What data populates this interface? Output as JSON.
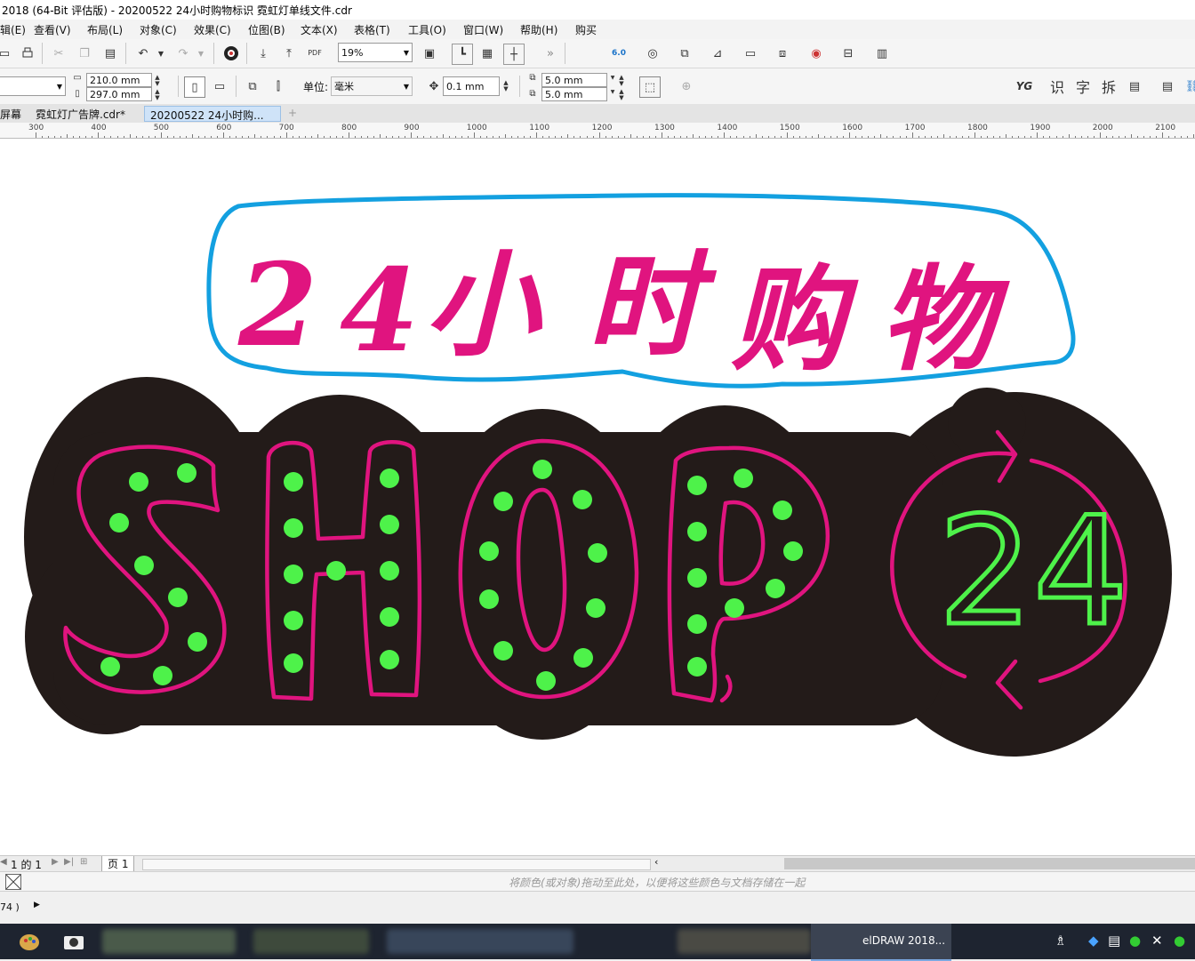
{
  "window": {
    "title": "2018 (64-Bit 评估版) - 20200522  24小时购物标识 霓虹灯单线文件.cdr"
  },
  "menu": {
    "items": [
      "辑(E)",
      "查看(V)",
      "布局(L)",
      "对象(C)",
      "效果(C)",
      "位图(B)",
      "文本(X)",
      "表格(T)",
      "工具(O)",
      "窗口(W)",
      "帮助(H)",
      "购买"
    ]
  },
  "toolbar": {
    "zoom": "19%",
    "pdf_label": "PDF",
    "cut_badge": "6.0"
  },
  "property_bar": {
    "width": "210.0 mm",
    "height": "297.0 mm",
    "unit_label": "单位:",
    "unit_value": "毫米",
    "nudge": "0.1 mm",
    "dup_x": "5.0 mm",
    "dup_y": "5.0 mm",
    "plugin_labels": [
      "YG",
      "识",
      "字",
      "拆"
    ]
  },
  "tabs": [
    {
      "label": "屏幕"
    },
    {
      "label": "霓虹灯广告牌.cdr*"
    },
    {
      "label": "20200522  24小时购..."
    }
  ],
  "ruler": {
    "labels": [
      "300",
      "400",
      "500",
      "600",
      "700",
      "800",
      "900",
      "1000",
      "1100",
      "1200",
      "1300",
      "1400",
      "1500",
      "1600",
      "1700",
      "1800",
      "1900",
      "2000",
      "2100"
    ]
  },
  "artwork": {
    "headline": [
      "2",
      "4",
      "小",
      "时",
      "购",
      "物"
    ],
    "letters": [
      "S",
      "H",
      "O",
      "P"
    ],
    "badge_number": "24",
    "colors": {
      "magenta": "#e0147f",
      "green": "#4ef24a",
      "cloud": "#13a0e0",
      "dark": "#231b19"
    }
  },
  "page_nav": {
    "count_text": "1 的 1",
    "page_tab": "页 1"
  },
  "palette_hint": "将颜色(或对象)拖动至此处，以便将这些颜色与文档存储在一起",
  "status": {
    "left_text": "74 )"
  },
  "taskbar": {
    "active_app": "elDRAW 2018..."
  }
}
